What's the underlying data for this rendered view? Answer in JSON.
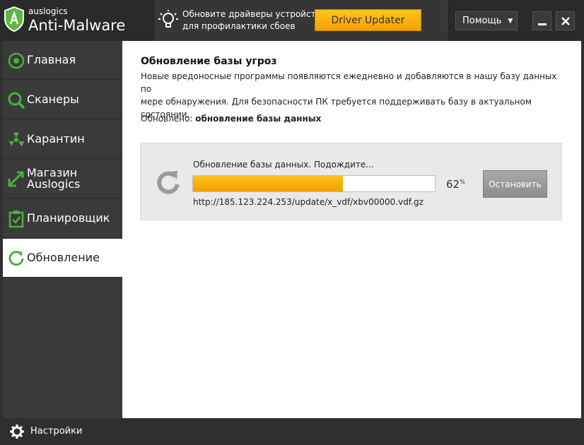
{
  "header": {
    "brand_small": "auslogics",
    "brand_big": "Anti-Malware",
    "promo_line1": "Обновите драйверы устройств",
    "promo_line2": "для профилактики сбоев",
    "driver_button": "Driver Updater",
    "help_label": "Помощь",
    "minimize_icon": "minimize-icon",
    "close_icon": "close-icon"
  },
  "sidebar": {
    "items": [
      {
        "label": "Главная",
        "icon": "home-icon"
      },
      {
        "label": "Сканеры",
        "icon": "search-icon"
      },
      {
        "label": "Карантин",
        "icon": "radiation-icon"
      },
      {
        "label_line1": "Магазин",
        "label_line2": "Auslogics",
        "icon": "shop-icon"
      },
      {
        "label": "Планировщик",
        "icon": "scheduler-icon"
      },
      {
        "label": "Обновление",
        "icon": "update-icon",
        "active": true
      }
    ]
  },
  "content": {
    "title": "Обновление базы угроз",
    "description_line1": "Новые вредоносные программы появляются ежедневно и добавляются в нашу базу данных по",
    "description_line2": "мере обнаружения. Для безопасности ПК требуется поддерживать базу в актуальном состоянии.",
    "updated_label": "Обновлено:",
    "updated_value": "обновление базы данных",
    "status_text": "Обновление базы данных. Подождите...",
    "progress_value": "62",
    "progress_unit": "%",
    "progress_fraction": 0.62,
    "url": "http://185.123.224.253/update/x_vdf/xbv00000.vdf.gz",
    "stop_button": "Остановить"
  },
  "footer": {
    "settings_label": "Настройки"
  },
  "colors": {
    "accent_green": "#4caf3f",
    "accent_orange": "#f7a800",
    "sidebar_bg": "#3a3a3a"
  }
}
